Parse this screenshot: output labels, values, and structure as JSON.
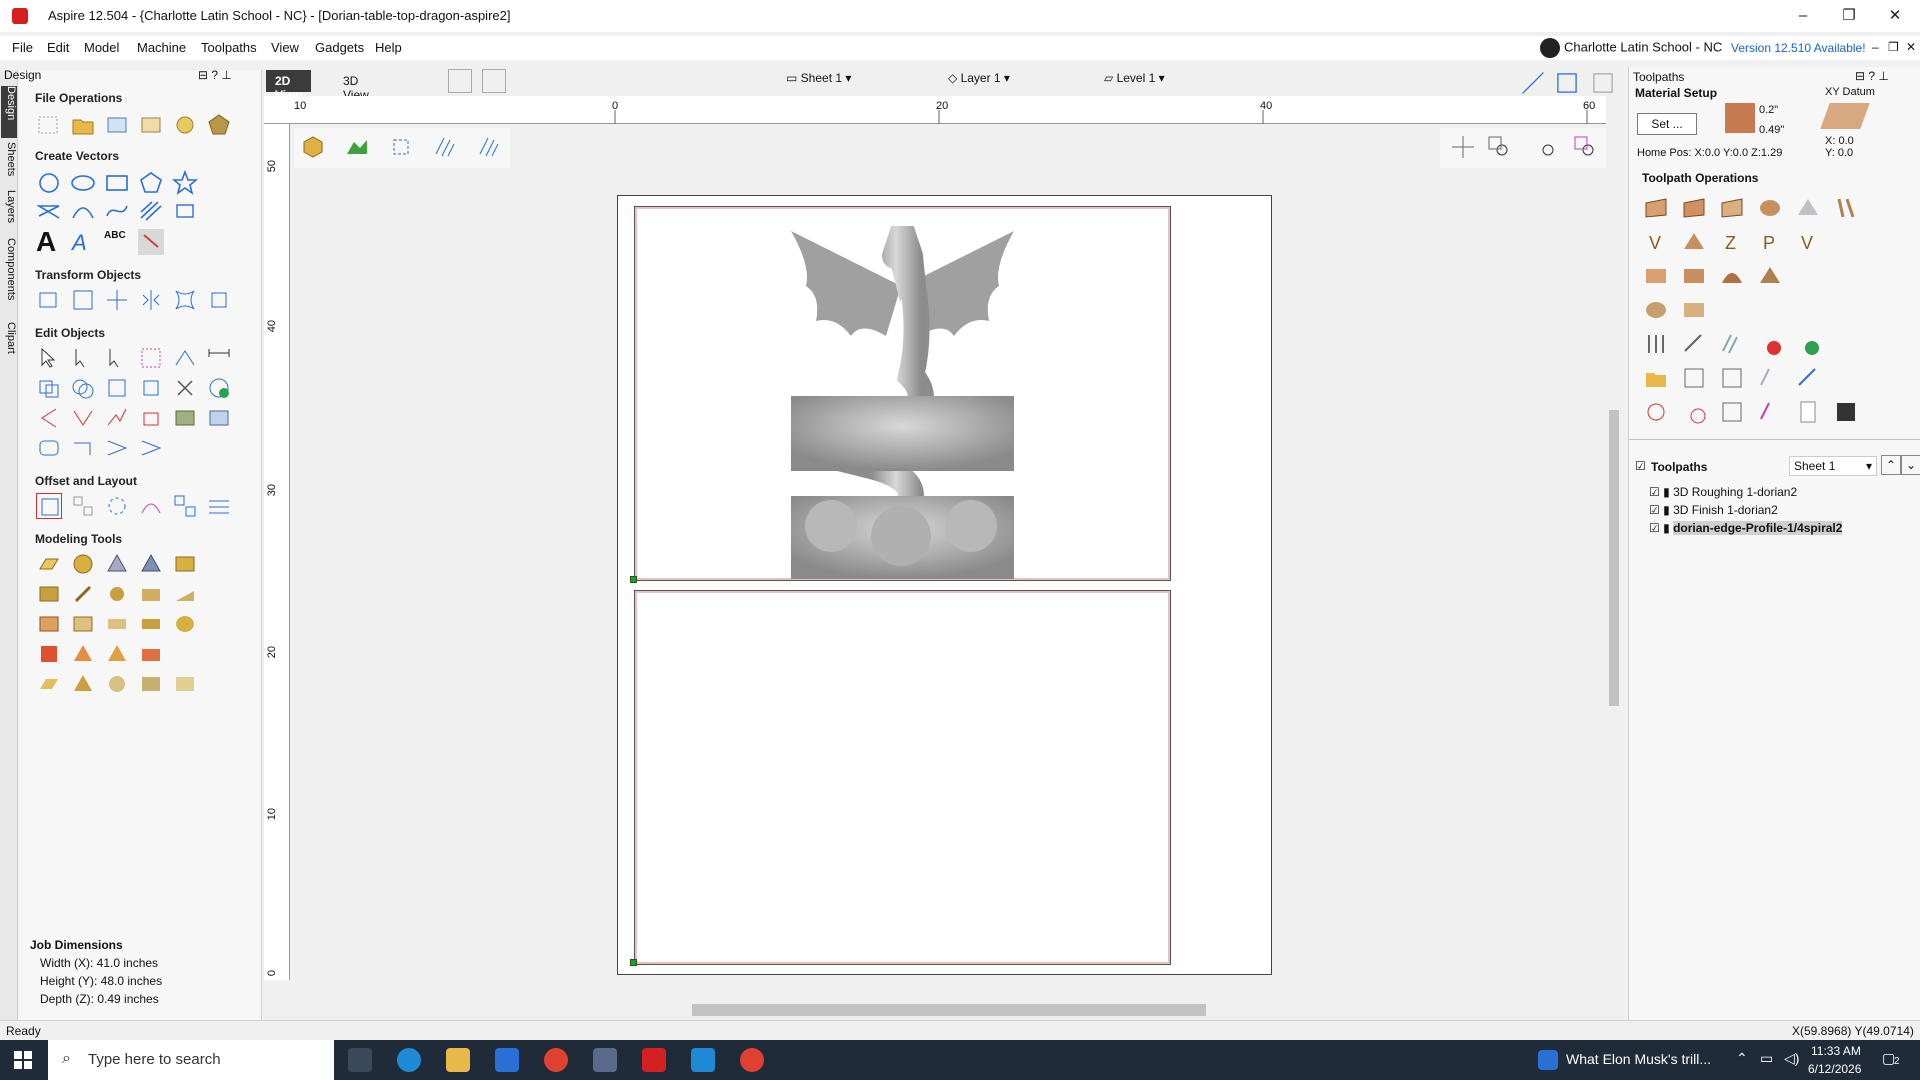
{
  "window": {
    "title": "Aspire 12.504 - {Charlotte Latin School - NC} - [Dorian-table-top-dragon-aspire2]",
    "min": "–",
    "restore": "❐",
    "close": "✕"
  },
  "menu": [
    "File",
    "Edit",
    "Model",
    "Machine",
    "Toolpaths",
    "View",
    "Gadgets",
    "Help"
  ],
  "user": {
    "name": "Charlotte Latin School - NC",
    "version_link": "Version 12.510 Available!"
  },
  "mdi": {
    "min": "–",
    "restore": "❐",
    "close": "✕"
  },
  "left_tabs": [
    "Design",
    "Sheets",
    "Layers",
    "Components",
    "Clipart"
  ],
  "design_panel": {
    "header": "Design",
    "sections": {
      "file_ops": "File Operations",
      "create_vectors": "Create Vectors",
      "transform": "Transform Objects",
      "edit": "Edit Objects",
      "offset": "Offset and Layout",
      "modeling": "Modeling Tools"
    },
    "text_tools": {
      "big_a": "A",
      "styled_a": "A",
      "abc": "ABC"
    },
    "job_dimensions": {
      "title": "Job Dimensions",
      "width": "Width  (X): 41.0 inches",
      "height": "Height (Y): 48.0 inches",
      "depth": "Depth  (Z): 0.49 inches"
    }
  },
  "view_tabs": [
    "2D View",
    "3D View"
  ],
  "toolbar": {
    "sheet": "Sheet 1",
    "layer": "Layer 1",
    "level": "Level 1"
  },
  "ruler": {
    "h_labels": [
      "0",
      "20",
      "40",
      "60"
    ],
    "v_labels": [
      "50",
      "40",
      "30",
      "20",
      "10",
      "0"
    ]
  },
  "right_panel": {
    "header": "Toolpaths",
    "material_setup": "Material Setup",
    "set_button": "Set ...",
    "top_offset": "0.2\"",
    "thickness": "0.49\"",
    "xy_datum": "XY Datum",
    "datum_x": "X: 0.0",
    "datum_y": "Y: 0.0",
    "home_pos": "Home Pos:  X:0.0 Y:0.0 Z:1.29",
    "toolpath_ops": "Toolpath Operations",
    "toolpaths_title": "Toolpaths",
    "sheet_select": "Sheet 1",
    "toolpath_list": [
      {
        "name": "3D Roughing 1-dorian2",
        "checked": true,
        "selected": false
      },
      {
        "name": "3D Finish 1-dorian2",
        "checked": true,
        "selected": false
      },
      {
        "name": "dorian-edge-Profile-1/4spiral2",
        "checked": true,
        "selected": true
      }
    ]
  },
  "status": {
    "left": "Ready",
    "coords": "X(59.8968) Y(49.0714)"
  },
  "taskbar": {
    "search_placeholder": "Type here to search",
    "news": "What Elon Musk's trill...",
    "time": "11:33 AM",
    "date": "6/12/2026",
    "notif_count": "2"
  },
  "colors": {
    "accent": "#1a62c7",
    "app_red": "#d42020",
    "taskbar": "#1f2b38",
    "toolpath_vec": "#c08080"
  }
}
